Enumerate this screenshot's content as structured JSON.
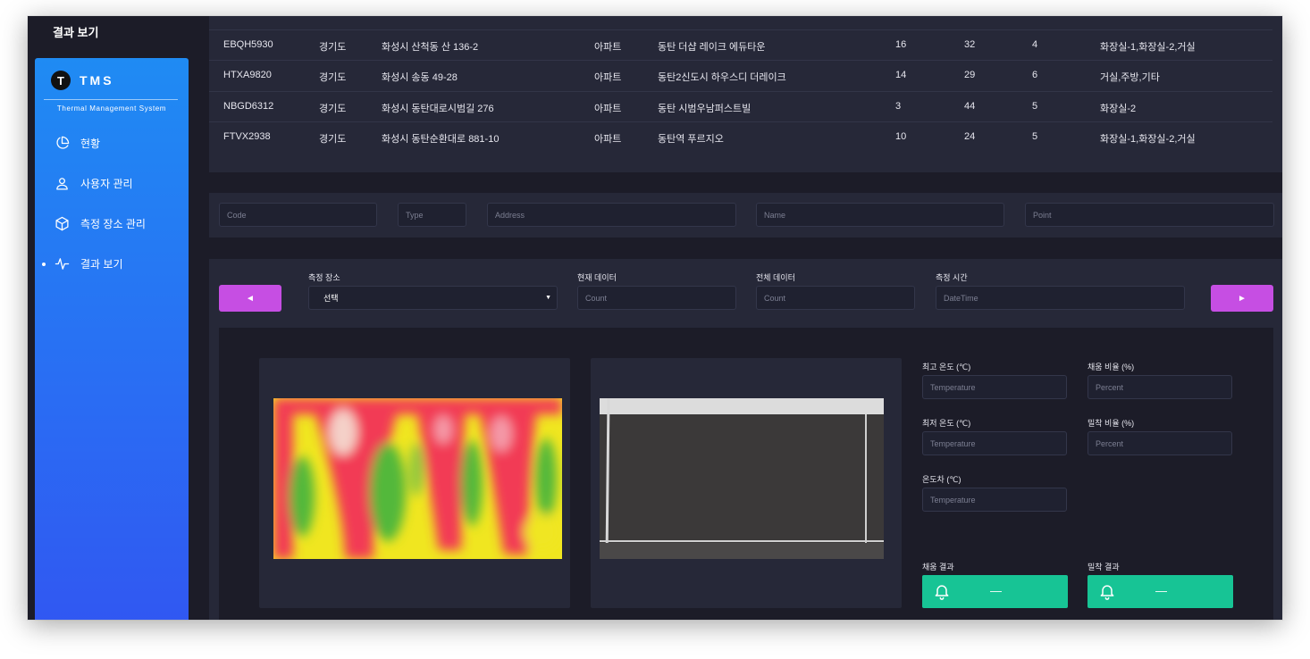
{
  "page": {
    "title": "결과 보기"
  },
  "brand": {
    "logo_letter": "T",
    "name": "TMS",
    "subtitle": "Thermal Management System"
  },
  "sidebar": {
    "items": [
      {
        "label": "현황",
        "icon": "pie-chart-icon"
      },
      {
        "label": "사용자 관리",
        "icon": "user-icon"
      },
      {
        "label": "측정 장소 관리",
        "icon": "cube-icon"
      },
      {
        "label": "결과 보기",
        "icon": "pulse-icon",
        "active": true
      }
    ]
  },
  "table": {
    "rows": [
      [
        "EBQH5930",
        "경기도",
        "화성시 산척동 산 136-2",
        "아파트",
        "동탄 더샵 레이크 에듀타운",
        "16",
        "32",
        "4",
        "화장실-1,화장실-2,거실"
      ],
      [
        "HTXA9820",
        "경기도",
        "화성시 송동 49-28",
        "아파트",
        "동탄2신도시 하우스디 더레이크",
        "14",
        "29",
        "6",
        "거실,주방,기타"
      ],
      [
        "NBGD6312",
        "경기도",
        "화성시 동탄대로시범길 276",
        "아파트",
        "동탄 시범우남퍼스트빌",
        "3",
        "44",
        "5",
        "화장실-2"
      ],
      [
        "FTVX2938",
        "경기도",
        "화성시 동탄순환대로 881-10",
        "아파트",
        "동탄역 푸르지오",
        "10",
        "24",
        "5",
        "화장실-1,화장실-2,거실"
      ]
    ]
  },
  "search": {
    "code_placeholder": "Code",
    "type_placeholder": "Type",
    "address_placeholder": "Address",
    "name_placeholder": "Name",
    "point_placeholder": "Point"
  },
  "measure": {
    "prev_label": "◄",
    "next_label": "►",
    "location_label": "측정 장소",
    "location_value": "선택",
    "current_label": "현재 데이터",
    "current_placeholder": "Count",
    "total_label": "전체 데이터",
    "total_placeholder": "Count",
    "time_label": "측정 시간",
    "time_placeholder": "DateTime"
  },
  "stats": {
    "max_temp_label": "최고 온도 (℃)",
    "min_temp_label": "최저 온도 (℃)",
    "temp_diff_label": "온도차 (℃)",
    "fill_ratio_label": "채움 비율 (%)",
    "adhesion_ratio_label": "밀착 비율 (%)",
    "temp_placeholder": "Temperature",
    "percent_placeholder": "Percent",
    "fill_result_label": "채움 결과",
    "adhesion_result_label": "밀착 결과",
    "fill_result_value": "—",
    "adhesion_result_value": "—"
  },
  "colors": {
    "sidebar_top": "#1f8bf3",
    "sidebar_bottom": "#3157f2",
    "nav_button": "#c64ee3",
    "result_button": "#17c495",
    "background": "#1c1c28",
    "panel": "#262838"
  }
}
